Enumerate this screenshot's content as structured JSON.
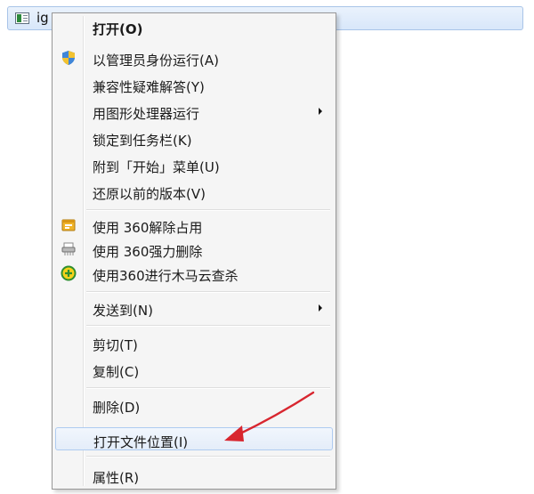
{
  "file": {
    "name": "ig"
  },
  "menu": {
    "items": [
      {
        "label": "打开(O)"
      },
      {
        "label": "以管理员身份运行(A)",
        "icon": "uac-shield-icon"
      },
      {
        "label": "兼容性疑难解答(Y)"
      },
      {
        "label": "用图形处理器运行"
      },
      {
        "label": "锁定到任务栏(K)"
      },
      {
        "label": "附到「开始」菜单(U)"
      },
      {
        "label": "还原以前的版本(V)"
      },
      {
        "label": "使用 360解除占用",
        "icon": "360-unlock-icon"
      },
      {
        "label": "使用 360强力删除",
        "icon": "360-shredder-icon"
      },
      {
        "label": "使用360进行木马云查杀",
        "icon": "360-trojan-scan-icon"
      },
      {
        "label": "发送到(N)"
      },
      {
        "label": "剪切(T)"
      },
      {
        "label": "复制(C)"
      },
      {
        "label": "删除(D)"
      },
      {
        "label": "打开文件位置(I)"
      },
      {
        "label": "属性(R)"
      }
    ]
  },
  "colors": {
    "annotation_arrow": "#d8262f",
    "hover_border": "#aecbf0",
    "menu_background": "#f5f5f5"
  }
}
